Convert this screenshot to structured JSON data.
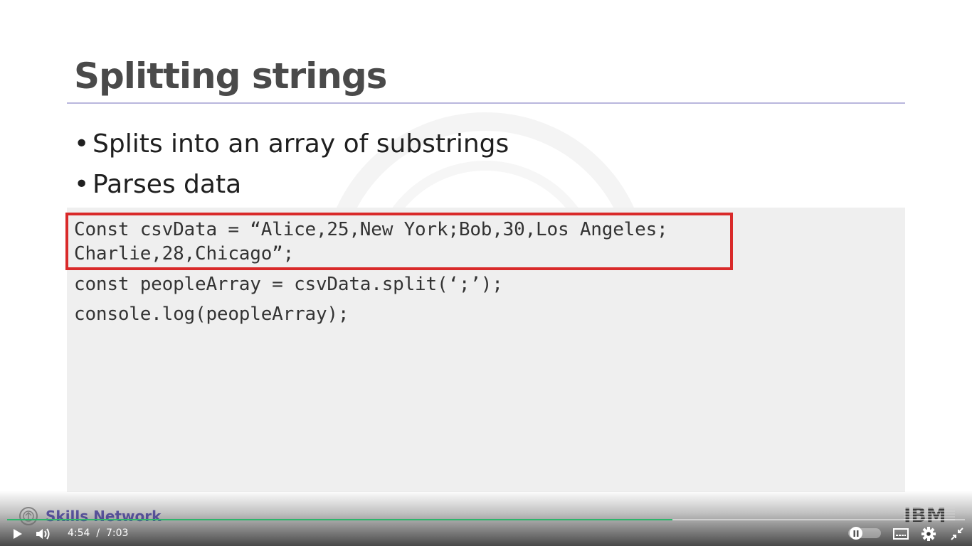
{
  "slide": {
    "title": "Splitting strings",
    "bullets": [
      "Splits into an array of substrings",
      "Parses data"
    ],
    "bullet_char": "•",
    "code_lines": [
      "Const csvData = “Alice,25,New York;Bob,30,Los Angeles;",
      "Charlie,28,Chicago”;",
      "const peopleArray = csvData.split(‘;’);",
      "console.log(peopleArray);"
    ],
    "highlight_color": "#d92a2a",
    "rule_color": "#b9b7dd"
  },
  "branding": {
    "left_logo_text": "Skills Network",
    "right_logo_text": "IBM"
  },
  "player": {
    "current_time": "4:54",
    "separator": "/",
    "duration": "7:03",
    "progress_fraction": 0.695,
    "progress_color": "#2eb56b",
    "controls": [
      "play-icon",
      "volume-icon",
      "speed-slider",
      "captions-icon",
      "settings-icon",
      "exit-fullscreen-icon"
    ]
  }
}
